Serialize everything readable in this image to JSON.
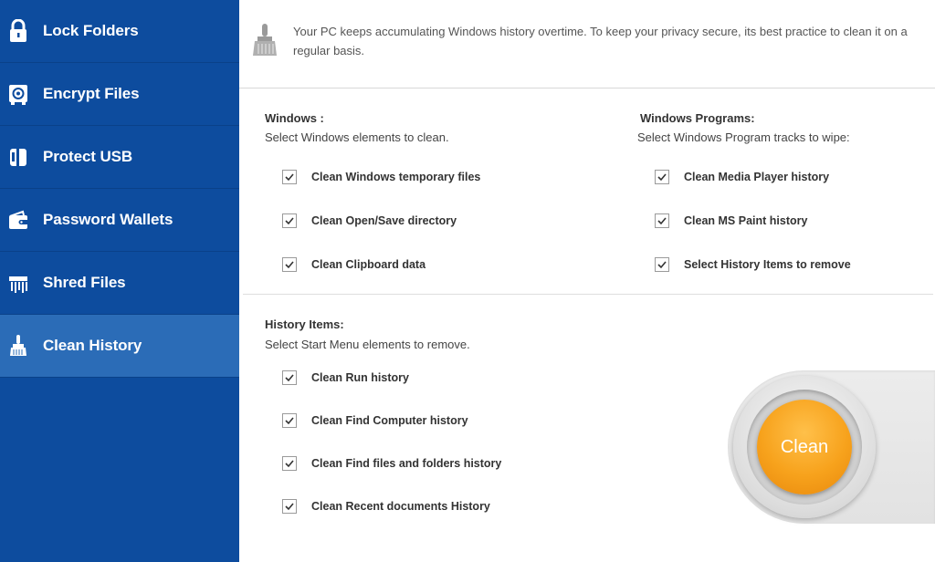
{
  "sidebar": {
    "items": [
      {
        "label": "Lock Folders",
        "icon": "lock-icon"
      },
      {
        "label": "Encrypt Files",
        "icon": "safe-icon"
      },
      {
        "label": "Protect USB",
        "icon": "usb-icon"
      },
      {
        "label": "Password Wallets",
        "icon": "wallet-icon"
      },
      {
        "label": "Shred Files",
        "icon": "shredder-icon"
      },
      {
        "label": "Clean History",
        "icon": "broom-icon",
        "active": true
      }
    ]
  },
  "notice": {
    "text": "Your PC keeps accumulating Windows history overtime. To keep your privacy secure, its best practice to clean it on a regular basis.",
    "icon": "broom-icon"
  },
  "windows": {
    "title": "Windows :",
    "subtitle": "Select Windows elements to clean.",
    "options": [
      {
        "label": "Clean Windows temporary files",
        "checked": true
      },
      {
        "label": "Clean Open/Save directory",
        "checked": true
      },
      {
        "label": "Clean Clipboard data",
        "checked": true
      }
    ]
  },
  "programs": {
    "title": "Windows Programs:",
    "subtitle": "Select Windows Program tracks to wipe:",
    "options": [
      {
        "label": "Clean Media Player history",
        "checked": true
      },
      {
        "label": "Clean MS Paint history",
        "checked": true
      },
      {
        "label": "Select History Items to remove",
        "checked": true
      }
    ]
  },
  "history": {
    "title": "History Items:",
    "subtitle": "Select Start Menu elements to remove.",
    "options": [
      {
        "label": "Clean Run history",
        "checked": true
      },
      {
        "label": "Clean Find Computer history",
        "checked": true
      },
      {
        "label": "Clean Find files and folders history",
        "checked": true
      },
      {
        "label": "Clean Recent documents History",
        "checked": true
      }
    ]
  },
  "clean_button": {
    "label": "Clean"
  },
  "colors": {
    "sidebar": "#0d4c9e",
    "sidebar_active": "#2b6cb7",
    "button": "#f7a21c"
  }
}
